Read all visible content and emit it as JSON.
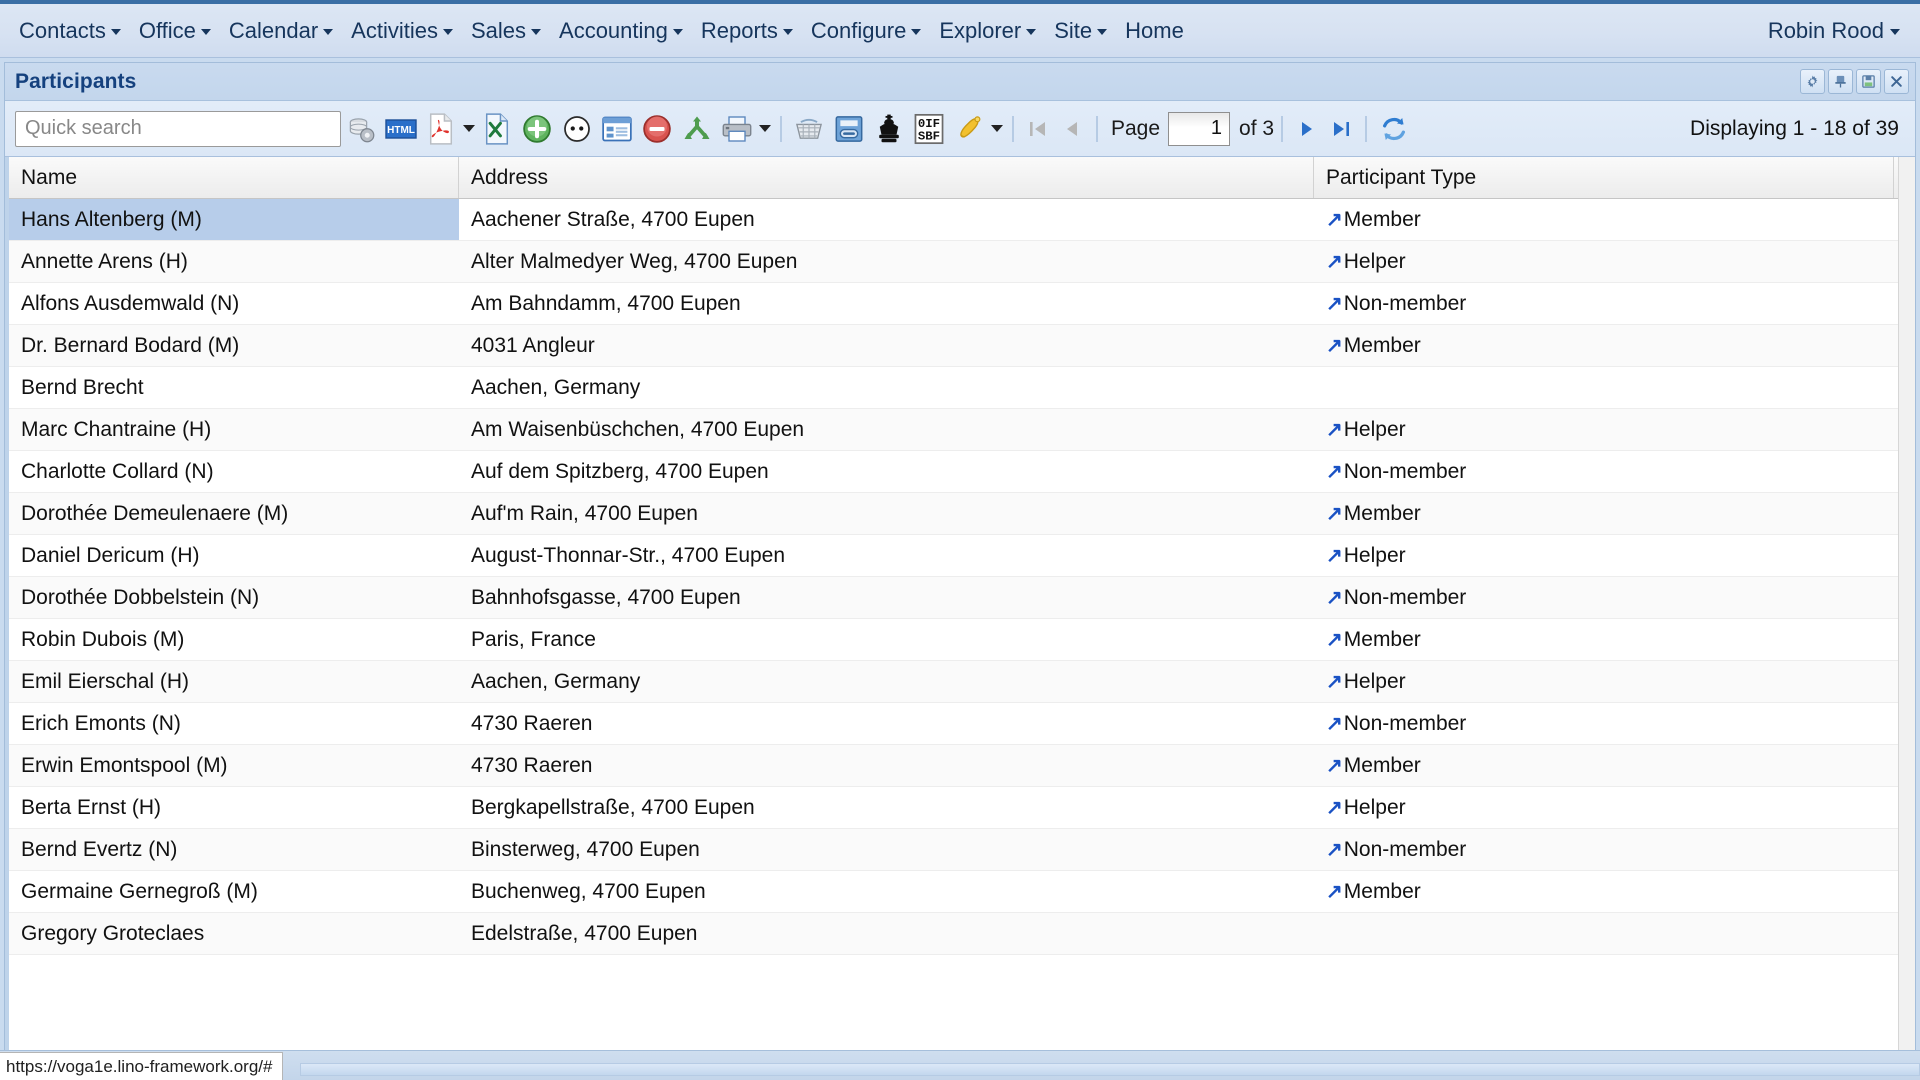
{
  "menubar": {
    "items": [
      {
        "label": "Contacts",
        "has_caret": true
      },
      {
        "label": "Office",
        "has_caret": true
      },
      {
        "label": "Calendar",
        "has_caret": true
      },
      {
        "label": "Activities",
        "has_caret": true
      },
      {
        "label": "Sales",
        "has_caret": true
      },
      {
        "label": "Accounting",
        "has_caret": true
      },
      {
        "label": "Reports",
        "has_caret": true
      },
      {
        "label": "Configure",
        "has_caret": true
      },
      {
        "label": "Explorer",
        "has_caret": true
      },
      {
        "label": "Site",
        "has_caret": true
      },
      {
        "label": "Home",
        "has_caret": false
      }
    ],
    "user": "Robin Rood"
  },
  "window": {
    "title": "Participants",
    "buttons": [
      {
        "name": "gear-icon",
        "tooltip": "Settings"
      },
      {
        "name": "pin-icon",
        "tooltip": "Pin"
      },
      {
        "name": "save-icon",
        "tooltip": "Save"
      },
      {
        "name": "close-icon",
        "tooltip": "Close"
      }
    ]
  },
  "toolbar": {
    "search_placeholder": "Quick search",
    "search_value": "",
    "icons": [
      {
        "name": "database-settings-icon"
      },
      {
        "name": "html-export-icon",
        "label": "HTML"
      },
      {
        "name": "pdf-export-icon",
        "has_caret": true
      },
      {
        "name": "excel-export-icon"
      },
      {
        "name": "insert-record-icon"
      },
      {
        "name": "duplicate-row-icon"
      },
      {
        "name": "detail-form-icon"
      },
      {
        "name": "delete-record-icon"
      },
      {
        "name": "merge-rows-icon"
      },
      {
        "name": "print-icon",
        "has_caret": true
      },
      {
        "name": "basket-icon"
      },
      {
        "name": "book-link-icon"
      },
      {
        "name": "crown-icon"
      },
      {
        "name": "seven-segment-icon",
        "label_top": "0IF",
        "label_bottom": "SBF"
      },
      {
        "name": "bell-icon",
        "has_caret": true
      }
    ],
    "pagination": {
      "first_label": "First page",
      "prev_label": "Previous page",
      "page_label": "Page",
      "page_value": "1",
      "of_label": "of 3",
      "next_label": "Next page",
      "last_label": "Last page",
      "refresh_label": "Refresh"
    },
    "displaying": "Displaying 1 - 18 of 39"
  },
  "grid": {
    "columns": [
      {
        "key": "name",
        "label": "Name"
      },
      {
        "key": "address",
        "label": "Address"
      },
      {
        "key": "type",
        "label": "Participant Type"
      }
    ],
    "rows": [
      {
        "name": "Hans Altenberg (M)",
        "address": "Aachener Straße, 4700 Eupen",
        "type": "Member",
        "selected": true
      },
      {
        "name": "Annette Arens (H)",
        "address": "Alter Malmedyer Weg, 4700 Eupen",
        "type": "Helper",
        "selected": false
      },
      {
        "name": "Alfons Ausdemwald (N)",
        "address": "Am Bahndamm, 4700 Eupen",
        "type": "Non-member",
        "selected": false
      },
      {
        "name": "Dr. Bernard Bodard (M)",
        "address": "4031 Angleur",
        "type": "Member",
        "selected": false
      },
      {
        "name": "Bernd Brecht",
        "address": "Aachen, Germany",
        "type": "",
        "selected": false
      },
      {
        "name": "Marc Chantraine (H)",
        "address": "Am Waisenbüschchen, 4700 Eupen",
        "type": "Helper",
        "selected": false
      },
      {
        "name": "Charlotte Collard (N)",
        "address": "Auf dem Spitzberg, 4700 Eupen",
        "type": "Non-member",
        "selected": false
      },
      {
        "name": "Dorothée Demeulenaere (M)",
        "address": "Auf'm Rain, 4700 Eupen",
        "type": "Member",
        "selected": false
      },
      {
        "name": "Daniel Dericum (H)",
        "address": "August-Thonnar-Str., 4700 Eupen",
        "type": "Helper",
        "selected": false
      },
      {
        "name": "Dorothée Dobbelstein (N)",
        "address": "Bahnhofsgasse, 4700 Eupen",
        "type": "Non-member",
        "selected": false
      },
      {
        "name": "Robin Dubois (M)",
        "address": "Paris, France",
        "type": "Member",
        "selected": false
      },
      {
        "name": "Emil Eierschal (H)",
        "address": "Aachen, Germany",
        "type": "Helper",
        "selected": false
      },
      {
        "name": "Erich Emonts (N)",
        "address": "4730 Raeren",
        "type": "Non-member",
        "selected": false
      },
      {
        "name": "Erwin Emontspool (M)",
        "address": "4730 Raeren",
        "type": "Member",
        "selected": false
      },
      {
        "name": "Berta Ernst (H)",
        "address": "Bergkapellstraße, 4700 Eupen",
        "type": "Helper",
        "selected": false
      },
      {
        "name": "Bernd Evertz (N)",
        "address": "Binsterweg, 4700 Eupen",
        "type": "Non-member",
        "selected": false
      },
      {
        "name": "Germaine Gernegroß (M)",
        "address": "Buchenweg, 4700 Eupen",
        "type": "Member",
        "selected": false
      },
      {
        "name": "Gregory Groteclaes",
        "address": "Edelstraße, 4700 Eupen",
        "type": "",
        "selected": false
      }
    ]
  },
  "statusbar": {
    "url": "https://voga1e.lino-framework.org/#"
  },
  "colors": {
    "accent": "#15417e",
    "menu_bg": "#d7e2f2",
    "panel_bg": "#c9dbef",
    "selected_row": "#b7cdea",
    "link": "#1a52c4"
  }
}
